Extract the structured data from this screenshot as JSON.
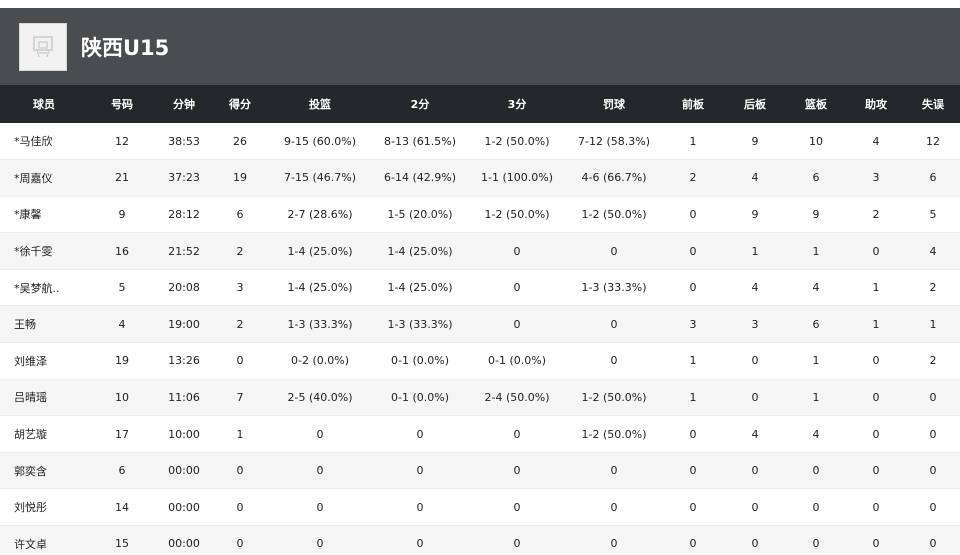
{
  "team": {
    "name": "陕西U15"
  },
  "columns": [
    "球员",
    "号码",
    "分钟",
    "得分",
    "投篮",
    "2分",
    "3分",
    "罚球",
    "前板",
    "后板",
    "篮板",
    "助攻",
    "失误"
  ],
  "players": [
    [
      "*马佳欣",
      "12",
      "38:53",
      "26",
      "9-15 (60.0%)",
      "8-13 (61.5%)",
      "1-2 (50.0%)",
      "7-12 (58.3%)",
      "1",
      "9",
      "10",
      "4",
      "12"
    ],
    [
      "*周嘉仪",
      "21",
      "37:23",
      "19",
      "7-15 (46.7%)",
      "6-14 (42.9%)",
      "1-1 (100.0%)",
      "4-6 (66.7%)",
      "2",
      "4",
      "6",
      "3",
      "6"
    ],
    [
      "*康馨",
      "9",
      "28:12",
      "6",
      "2-7 (28.6%)",
      "1-5 (20.0%)",
      "1-2 (50.0%)",
      "1-2 (50.0%)",
      "0",
      "9",
      "9",
      "2",
      "5"
    ],
    [
      "*徐千雯",
      "16",
      "21:52",
      "2",
      "1-4 (25.0%)",
      "1-4 (25.0%)",
      "0",
      "0",
      "0",
      "1",
      "1",
      "0",
      "4"
    ],
    [
      "*吴梦航..",
      "5",
      "20:08",
      "3",
      "1-4 (25.0%)",
      "1-4 (25.0%)",
      "0",
      "1-3 (33.3%)",
      "0",
      "4",
      "4",
      "1",
      "2"
    ],
    [
      "王畅",
      "4",
      "19:00",
      "2",
      "1-3 (33.3%)",
      "1-3 (33.3%)",
      "0",
      "0",
      "3",
      "3",
      "6",
      "1",
      "1"
    ],
    [
      "刘维泽",
      "19",
      "13:26",
      "0",
      "0-2 (0.0%)",
      "0-1 (0.0%)",
      "0-1 (0.0%)",
      "0",
      "1",
      "0",
      "1",
      "0",
      "2"
    ],
    [
      "吕晴瑶",
      "10",
      "11:06",
      "7",
      "2-5 (40.0%)",
      "0-1 (0.0%)",
      "2-4 (50.0%)",
      "1-2 (50.0%)",
      "1",
      "0",
      "1",
      "0",
      "0"
    ],
    [
      "胡艺璇",
      "17",
      "10:00",
      "1",
      "0",
      "0",
      "0",
      "1-2 (50.0%)",
      "0",
      "4",
      "4",
      "0",
      "0"
    ],
    [
      "郭奕含",
      "6",
      "00:00",
      "0",
      "0",
      "0",
      "0",
      "0",
      "0",
      "0",
      "0",
      "0",
      "0"
    ],
    [
      "刘悦彤",
      "14",
      "00:00",
      "0",
      "0",
      "0",
      "0",
      "0",
      "0",
      "0",
      "0",
      "0",
      "0"
    ],
    [
      "许文卓",
      "15",
      "00:00",
      "0",
      "0",
      "0",
      "0",
      "0",
      "0",
      "0",
      "0",
      "0",
      "0"
    ]
  ],
  "colors": {
    "header_band": "#4a4d50",
    "table_header": "#25282b",
    "row_alt": "#f5f5f5"
  },
  "icons": {
    "team_logo": "basketball-hoop-icon"
  }
}
